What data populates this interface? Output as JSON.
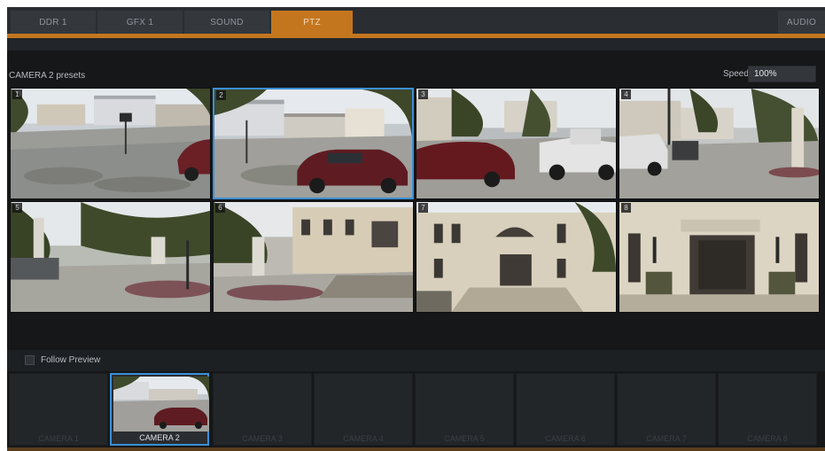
{
  "tabs": [
    {
      "label": "DDR 1",
      "active": false
    },
    {
      "label": "GFX 1",
      "active": false
    },
    {
      "label": "SOUND",
      "active": false
    },
    {
      "label": "PTZ",
      "active": true
    },
    {
      "label": "AUDIO",
      "active": false
    }
  ],
  "presets": {
    "title": "CAMERA 2 presets",
    "speed_label": "Speed",
    "speed_value": "100%",
    "items": [
      {
        "number": "1"
      },
      {
        "number": "2",
        "selected": true
      },
      {
        "number": "3"
      },
      {
        "number": "4"
      },
      {
        "number": "5"
      },
      {
        "number": "6"
      },
      {
        "number": "7"
      },
      {
        "number": "8"
      }
    ]
  },
  "follow_preview": {
    "label": "Follow Preview",
    "checked": false
  },
  "cameras": [
    {
      "label": "CAMERA 1",
      "active": false
    },
    {
      "label": "CAMERA 2",
      "active": true
    },
    {
      "label": "CAMERA 3",
      "active": false
    },
    {
      "label": "CAMERA 4",
      "active": false
    },
    {
      "label": "CAMERA 5",
      "active": false
    },
    {
      "label": "CAMERA 6",
      "active": false
    },
    {
      "label": "CAMERA 7",
      "active": false
    },
    {
      "label": "CAMERA 8",
      "active": false
    }
  ],
  "colors": {
    "accent": "#c4761e",
    "selection": "#3b8fd6",
    "background": "#151719"
  }
}
